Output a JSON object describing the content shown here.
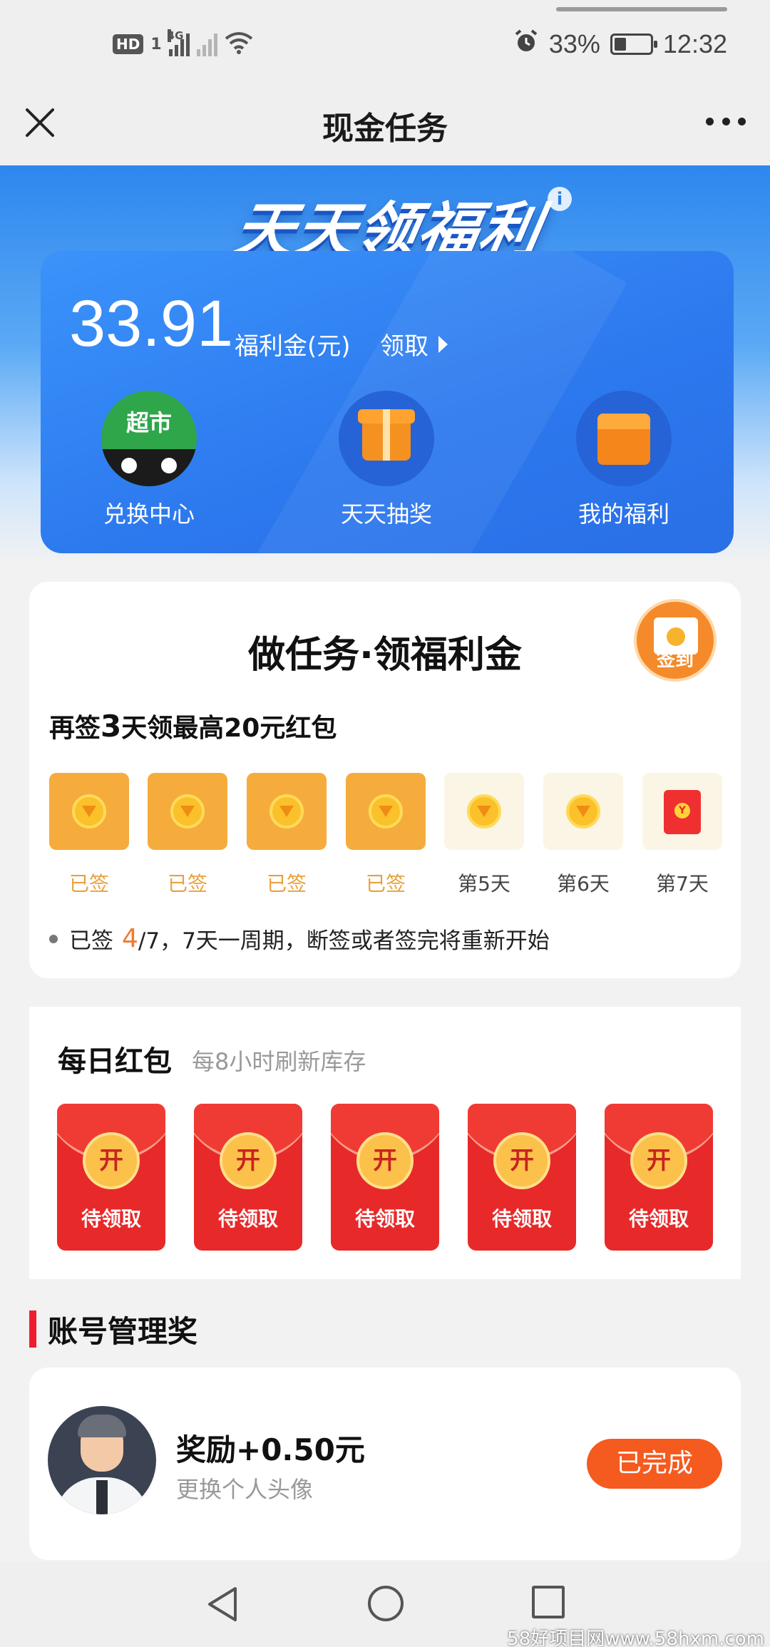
{
  "status_bar": {
    "hd": "HD",
    "sim": "1",
    "network": "4G",
    "battery": "33%",
    "battery_level": 0.33,
    "time": "12:32"
  },
  "header": {
    "title": "现金任务"
  },
  "hero": {
    "title": "天天领福利",
    "info": "i",
    "balance": "33.91",
    "balance_unit": "福利金(元)",
    "claim": "领取",
    "shortcuts": [
      {
        "label": "兑换中心",
        "badge": "超市",
        "icon": "tmall-supermarket-icon"
      },
      {
        "label": "天天抽奖",
        "icon": "gift-box-icon"
      },
      {
        "label": "我的福利",
        "icon": "welfare-box-icon"
      }
    ]
  },
  "sign_in": {
    "title": "做任务·领福利金",
    "badge_label": "签到",
    "subtitle_pre": "再签",
    "subtitle_num": "3",
    "subtitle_post": "天领最高20元红包",
    "days": [
      {
        "label": "已签",
        "state": "done"
      },
      {
        "label": "已签",
        "state": "done"
      },
      {
        "label": "已签",
        "state": "done"
      },
      {
        "label": "已签",
        "state": "done"
      },
      {
        "label": "第5天",
        "state": "todo"
      },
      {
        "label": "第6天",
        "state": "todo"
      },
      {
        "label": "第7天",
        "state": "todo",
        "reward": "red-packet"
      }
    ],
    "note_pre": "已签",
    "note_count": "4",
    "note_post": "/7，7天一周期，断签或者签完将重新开始"
  },
  "daily": {
    "title": "每日红包",
    "subtitle": "每8小时刷新库存",
    "packets": [
      {
        "open_label": "开",
        "status": "待领取"
      },
      {
        "open_label": "开",
        "status": "待领取"
      },
      {
        "open_label": "开",
        "status": "待领取"
      },
      {
        "open_label": "开",
        "status": "待领取"
      },
      {
        "open_label": "开",
        "status": "待领取"
      }
    ]
  },
  "account": {
    "section_title": "账号管理奖",
    "reward_title": "奖励+0.50元",
    "reward_desc": "更换个人头像",
    "button": "已完成"
  },
  "watermark": "58好项目网www.58hxm.com",
  "colors": {
    "primary_blue": "#2c78ee",
    "accent_orange": "#f55a1f",
    "gold": "#f5ac3c",
    "red": "#e8292a"
  }
}
